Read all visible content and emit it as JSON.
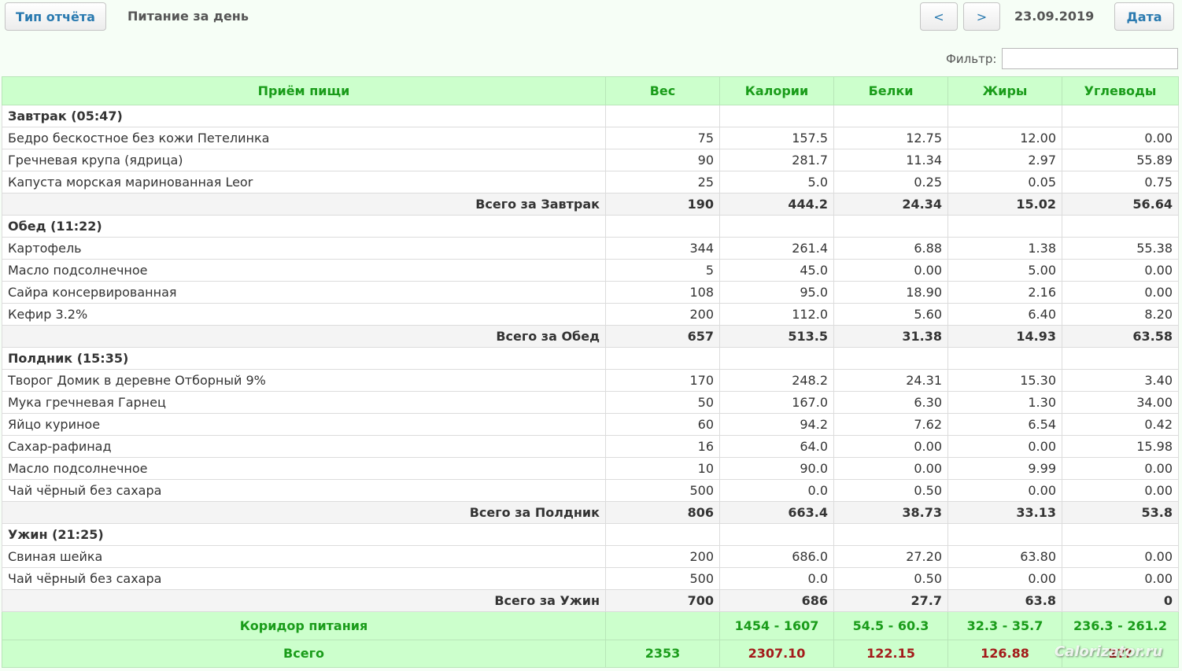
{
  "toolbar": {
    "report_type_label": "Тип отчёта",
    "title": "Питание за день",
    "prev_label": "<",
    "next_label": ">",
    "date": "23.09.2019",
    "date_label": "Дата"
  },
  "filter": {
    "label": "Фильтр:",
    "value": ""
  },
  "columns": [
    "Приём пищи",
    "Вес",
    "Калории",
    "Белки",
    "Жиры",
    "Углеводы"
  ],
  "meals": [
    {
      "title": "Завтрак (05:47)",
      "items": [
        {
          "name": "Бедро бескостное без кожи Петелинка",
          "weight": "75",
          "kcal": "157.5",
          "protein": "12.75",
          "fat": "12.00",
          "carbs": "0.00"
        },
        {
          "name": "Гречневая крупа (ядрица)",
          "weight": "90",
          "kcal": "281.7",
          "protein": "11.34",
          "fat": "2.97",
          "carbs": "55.89"
        },
        {
          "name": "Капуста морская маринованная Leor",
          "weight": "25",
          "kcal": "5.0",
          "protein": "0.25",
          "fat": "0.05",
          "carbs": "0.75"
        }
      ],
      "total": {
        "label": "Всего за Завтрак",
        "weight": "190",
        "kcal": "444.2",
        "protein": "24.34",
        "fat": "15.02",
        "carbs": "56.64"
      }
    },
    {
      "title": "Обед (11:22)",
      "items": [
        {
          "name": "Картофель",
          "weight": "344",
          "kcal": "261.4",
          "protein": "6.88",
          "fat": "1.38",
          "carbs": "55.38"
        },
        {
          "name": "Масло подсолнечное",
          "weight": "5",
          "kcal": "45.0",
          "protein": "0.00",
          "fat": "5.00",
          "carbs": "0.00"
        },
        {
          "name": "Сайра консервированная",
          "weight": "108",
          "kcal": "95.0",
          "protein": "18.90",
          "fat": "2.16",
          "carbs": "0.00"
        },
        {
          "name": "Кефир 3.2%",
          "weight": "200",
          "kcal": "112.0",
          "protein": "5.60",
          "fat": "6.40",
          "carbs": "8.20"
        }
      ],
      "total": {
        "label": "Всего за Обед",
        "weight": "657",
        "kcal": "513.5",
        "protein": "31.38",
        "fat": "14.93",
        "carbs": "63.58"
      }
    },
    {
      "title": "Полдник (15:35)",
      "items": [
        {
          "name": "Творог Домик в деревне Отборный 9%",
          "weight": "170",
          "kcal": "248.2",
          "protein": "24.31",
          "fat": "15.30",
          "carbs": "3.40"
        },
        {
          "name": "Мука гречневая Гарнец",
          "weight": "50",
          "kcal": "167.0",
          "protein": "6.30",
          "fat": "1.30",
          "carbs": "34.00"
        },
        {
          "name": "Яйцо куриное",
          "weight": "60",
          "kcal": "94.2",
          "protein": "7.62",
          "fat": "6.54",
          "carbs": "0.42"
        },
        {
          "name": "Сахар-рафинад",
          "weight": "16",
          "kcal": "64.0",
          "protein": "0.00",
          "fat": "0.00",
          "carbs": "15.98"
        },
        {
          "name": "Масло подсолнечное",
          "weight": "10",
          "kcal": "90.0",
          "protein": "0.00",
          "fat": "9.99",
          "carbs": "0.00"
        },
        {
          "name": "Чай чёрный без сахара",
          "weight": "500",
          "kcal": "0.0",
          "protein": "0.50",
          "fat": "0.00",
          "carbs": "0.00"
        }
      ],
      "total": {
        "label": "Всего за Полдник",
        "weight": "806",
        "kcal": "663.4",
        "protein": "38.73",
        "fat": "33.13",
        "carbs": "53.8"
      }
    },
    {
      "title": "Ужин (21:25)",
      "items": [
        {
          "name": "Свиная шейка",
          "weight": "200",
          "kcal": "686.0",
          "protein": "27.20",
          "fat": "63.80",
          "carbs": "0.00"
        },
        {
          "name": "Чай чёрный без сахара",
          "weight": "500",
          "kcal": "0.0",
          "protein": "0.50",
          "fat": "0.00",
          "carbs": "0.00"
        }
      ],
      "total": {
        "label": "Всего за Ужин",
        "weight": "700",
        "kcal": "686",
        "protein": "27.7",
        "fat": "63.8",
        "carbs": "0"
      }
    }
  ],
  "corridor": {
    "label": "Коридор питания",
    "weight": "",
    "kcal": "1454 - 1607",
    "protein": "54.5 - 60.3",
    "fat": "32.3 - 35.7",
    "carbs": "236.3 - 261.2"
  },
  "grand_total": {
    "label": "Всего",
    "weight": "2353",
    "kcal": "2307.10",
    "protein": "122.15",
    "fat": "126.88",
    "carbs": "2??"
  },
  "watermark": "Calorizator.ru",
  "colors": {
    "header_bg": "#ccffcc",
    "header_text": "#1a9c1a",
    "over_limit": "#a31a1a",
    "button_text": "#2a7ab0"
  }
}
